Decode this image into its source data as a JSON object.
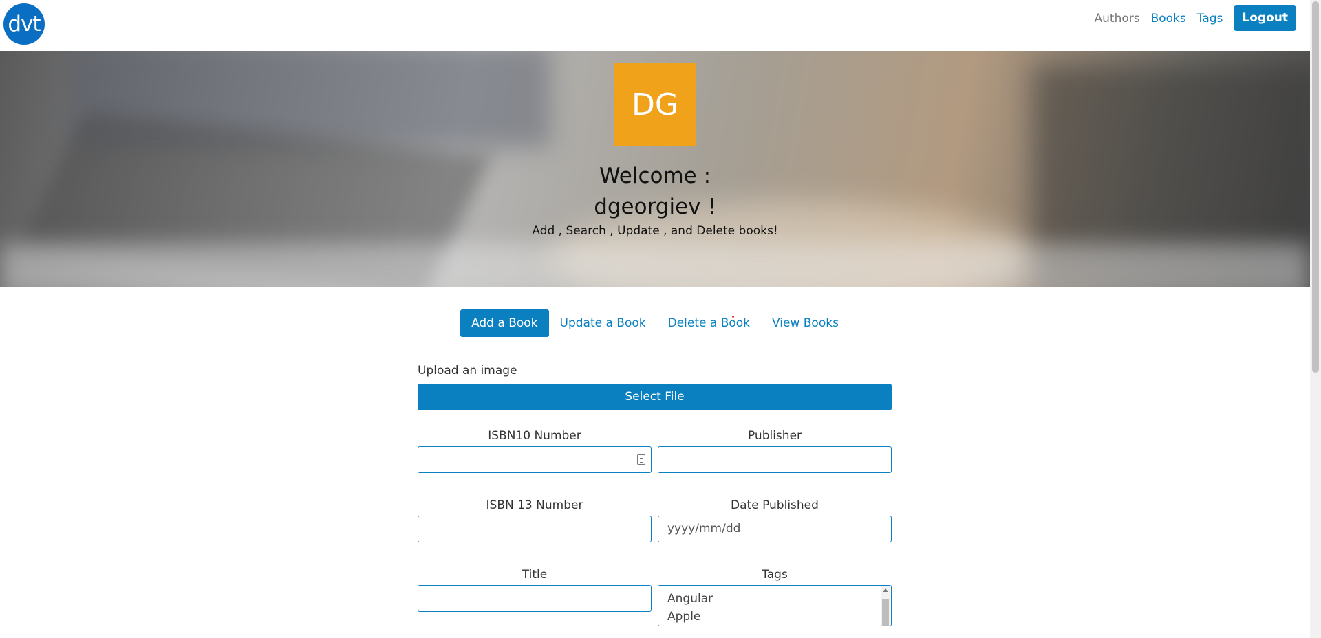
{
  "brand": {
    "logo_text": "dvt"
  },
  "nav": {
    "authors": "Authors",
    "books": "Books",
    "tags": "Tags",
    "logout": "Logout"
  },
  "hero": {
    "avatar_initials": "DG",
    "welcome_line1": "Welcome :",
    "welcome_line2": "dgeorgiev !",
    "subtitle": "Add , Search , Update , and Delete books!"
  },
  "tabs": [
    {
      "label": "Add a Book",
      "active": true
    },
    {
      "label": "Update a Book",
      "active": false
    },
    {
      "label": "Delete a Book",
      "active": false
    },
    {
      "label": "View Books",
      "active": false
    }
  ],
  "form": {
    "upload_label": "Upload an image",
    "select_file": "Select File",
    "isbn10_label": "ISBN10 Number",
    "isbn10_value": "",
    "publisher_label": "Publisher",
    "publisher_value": "",
    "isbn13_label": "ISBN 13 Number",
    "isbn13_value": "",
    "date_label": "Date Published",
    "date_placeholder": "yyyy/mm/dd",
    "title_label": "Title",
    "title_value": "",
    "tags_label": "Tags",
    "tags_options": [
      "Angular",
      "Apple"
    ]
  },
  "colors": {
    "accent": "#0a80c0",
    "logo_bg": "#0a6fc2",
    "avatar_bg": "#f0a21b"
  }
}
